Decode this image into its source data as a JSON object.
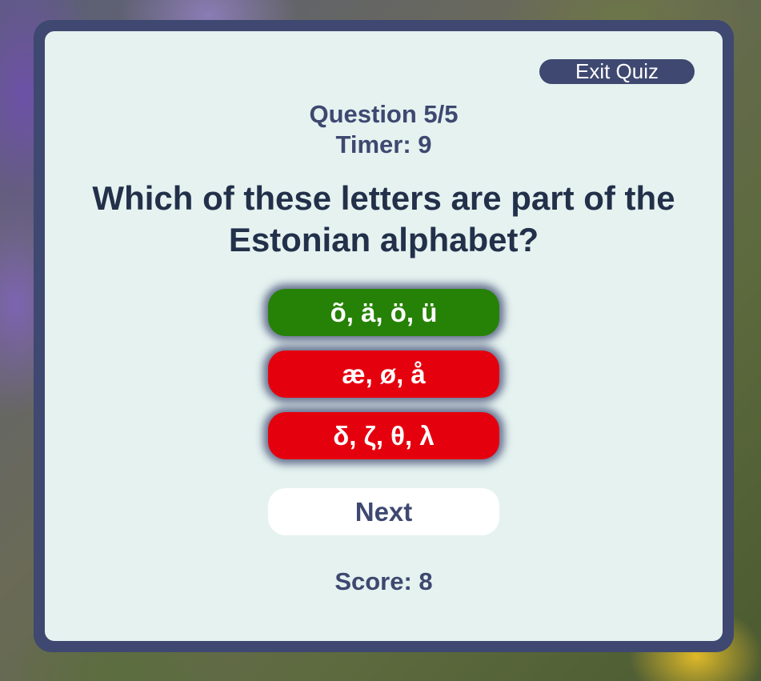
{
  "colors": {
    "frame": "#3e4870",
    "card_background": "#e5f2f0",
    "question_text": "#22304a",
    "correct_answer": "#268206",
    "wrong_answer": "#e5000e",
    "next_button": "#ffffff"
  },
  "header": {
    "exit_label": "Exit Quiz",
    "question_counter": "Question 5/5",
    "timer": "Timer: 9"
  },
  "question": {
    "text": "Which of these letters are part of the Estonian alphabet?"
  },
  "answers": [
    {
      "label": "õ, ä, ö, ü",
      "state": "correct"
    },
    {
      "label": "æ, ø, å",
      "state": "wrong"
    },
    {
      "label": "δ, ζ, θ, λ",
      "state": "wrong"
    }
  ],
  "controls": {
    "next_label": "Next"
  },
  "score": {
    "text": "Score: 8"
  }
}
